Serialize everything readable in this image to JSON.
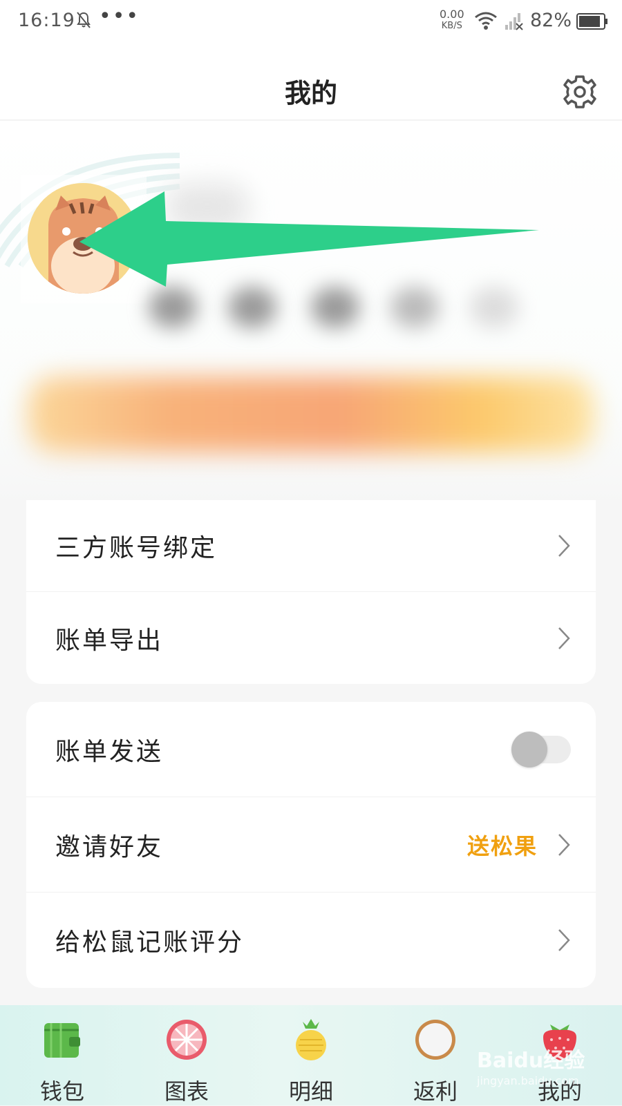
{
  "status_bar": {
    "time": "16:19",
    "dots": "•••",
    "net_speed_value": "0.00",
    "net_speed_unit": "KB/S",
    "battery": "82%"
  },
  "header": {
    "title": "我的"
  },
  "menu_group_1": [
    {
      "label": "三方账号绑定"
    },
    {
      "label": "账单导出"
    }
  ],
  "menu_group_2": {
    "bill_send": {
      "label": "账单发送",
      "toggle_on": false
    },
    "invite": {
      "label": "邀请好友",
      "extra": "送松果"
    },
    "rate": {
      "label": "给松鼠记账评分"
    }
  },
  "tabbar": [
    {
      "label": "钱包",
      "icon": "wallet-icon"
    },
    {
      "label": "图表",
      "icon": "chart-icon"
    },
    {
      "label": "明细",
      "icon": "detail-icon"
    },
    {
      "label": "返利",
      "icon": "rebate-icon"
    },
    {
      "label": "我的",
      "icon": "me-icon"
    }
  ],
  "watermark": {
    "text": "Baidu经验",
    "sub": "jingyan.baidu.com"
  },
  "colors": {
    "accent": "#f0a010",
    "arrow": "#2dcf8a",
    "tabbar": "#daf2ef"
  }
}
